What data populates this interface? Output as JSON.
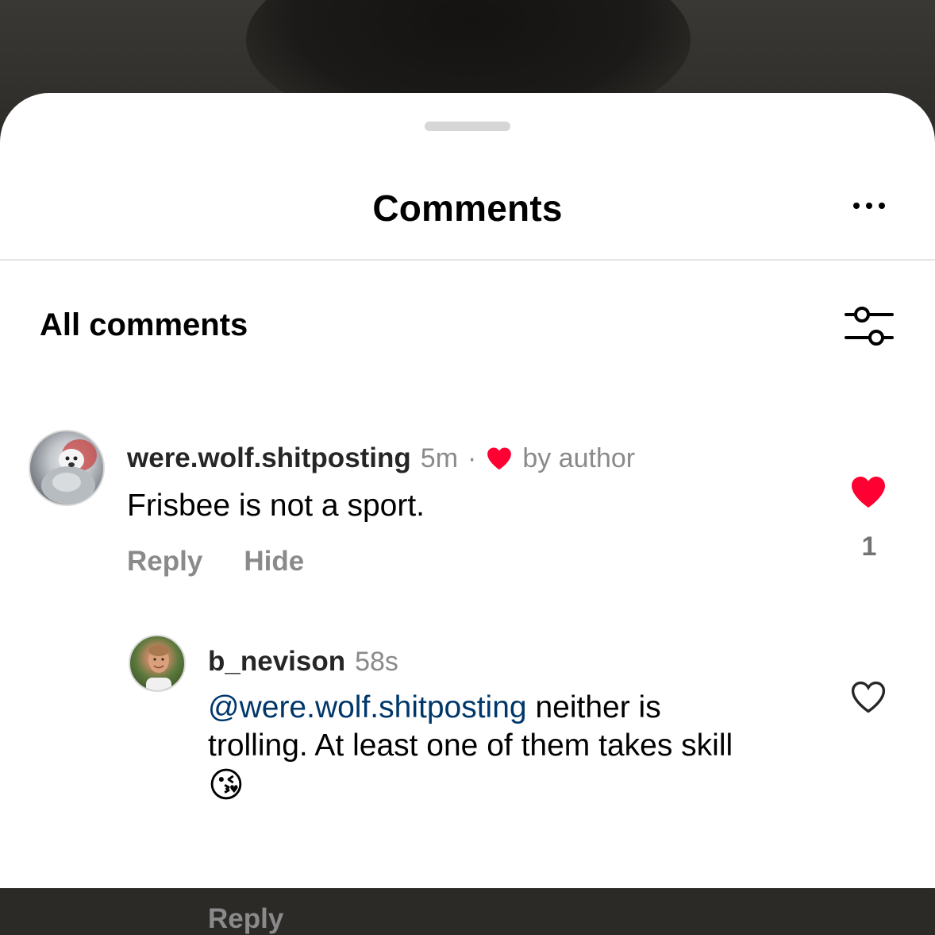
{
  "header": {
    "title": "Comments"
  },
  "filter": {
    "label": "All comments"
  },
  "comments": [
    {
      "username": "were.wolf.shitposting",
      "time": "5m",
      "separator": "·",
      "liked_by_author_label": "by author",
      "text": "Frisbee is not a sport.",
      "reply_label": "Reply",
      "hide_label": "Hide",
      "like_count": "1",
      "liked": true
    },
    {
      "username": "b_nevison",
      "time": "58s",
      "mention": "@were.wolf.shitposting",
      "text_line1_rest": " neither is",
      "text_line2": "trolling. At least one of them takes skill",
      "emoji": "😘",
      "reply_label": "Reply",
      "liked": false
    }
  ],
  "colors": {
    "heart": "#ff0033",
    "mention": "#00376b",
    "secondary_text": "#8a8a8a"
  },
  "icons": [
    "more-icon",
    "filter-sliders-icon",
    "heart-filled-icon",
    "heart-outline-icon"
  ]
}
